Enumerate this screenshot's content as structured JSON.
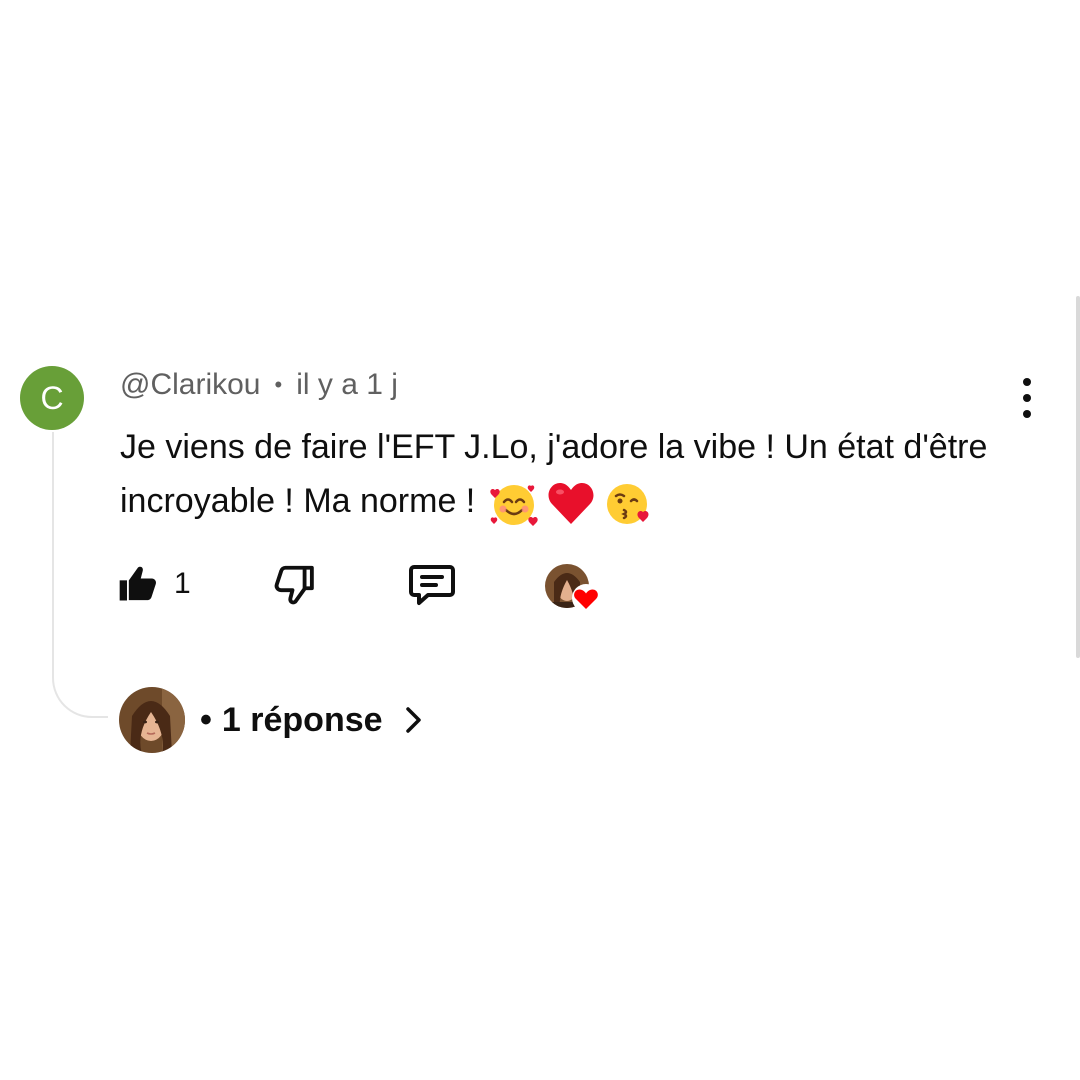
{
  "comment": {
    "avatar_letter": "C",
    "avatar_color": "#689f38",
    "author": "@Clarikou",
    "separator": "•",
    "timestamp": "il y a 1 j",
    "text": "Je viens de faire l'EFT J.Lo, j'adore la vibe ! Un état d'être incroyable ! Ma norme !",
    "emojis": [
      "smiling-face-with-hearts",
      "red-heart",
      "face-blowing-a-kiss"
    ],
    "more_icon": "vertical-ellipsis-icon"
  },
  "actions": {
    "like_icon": "thumbs-up-filled-icon",
    "like_count": "1",
    "dislike_icon": "thumbs-down-outline-icon",
    "reply_icon": "comment-icon",
    "creator_heart": "creator-heart-badge"
  },
  "replies": {
    "separator": "•",
    "label": "1 réponse",
    "chevron_icon": "chevron-right-icon"
  },
  "colors": {
    "text": "#0f0f0f",
    "secondary_text": "#606060",
    "heart": "#ff0000",
    "thread_line": "#e5e5e5"
  }
}
